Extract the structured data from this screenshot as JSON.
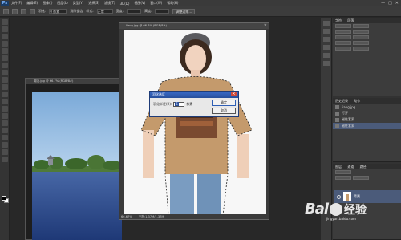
{
  "app": {
    "logo": "Ps",
    "menus": [
      "文件(F)",
      "编辑(E)",
      "图像(I)",
      "图层(L)",
      "类型(Y)",
      "选择(S)",
      "滤镜(T)",
      "3D(D)",
      "视图(V)",
      "窗口(W)",
      "帮助(H)"
    ],
    "window_controls": [
      "—",
      "□",
      "✕"
    ]
  },
  "options_bar": {
    "feather_label": "羽化:",
    "feather_value": "0 像素",
    "antialias_label": "消除锯齿",
    "style_label": "样式:",
    "style_value": "正常",
    "width_label": "宽度:",
    "height_label": "高度:",
    "refine_button": "调整边缘..."
  },
  "documents": {
    "lake": {
      "title": "湖泊.jpg @ 66.7% (RGB/8#)"
    },
    "girl": {
      "title": "liang.jpg @ 66.7% (RGB/8#)",
      "zoom": "66.67%",
      "doc_info": "文档:1.37M/1.37M"
    }
  },
  "dialog": {
    "title": "羽化选区",
    "radius_label": "羽化半径(R):",
    "radius_value": "5",
    "unit": "像素",
    "ok": "确定",
    "cancel": "取消"
  },
  "panels": {
    "character_tab": "字符",
    "paragraph_tab": "段落",
    "history_tab": "历史记录",
    "actions_tab": "动作",
    "history_items": [
      "liang.jpg",
      "打开",
      "磁性套索",
      "磁性套索"
    ],
    "history_selected_index": 3,
    "layers_tab": "图层",
    "channels_tab": "通道",
    "paths_tab": "路径",
    "layer_name": "背景"
  },
  "watermark": {
    "brand": "Bai",
    "brand_cn": "经验",
    "url": "jingyan.baidu.com"
  },
  "colors": {
    "accent_blue": "#2a4f9b",
    "selected_row": "#4b5b7a",
    "photoshop_bg": "#282828"
  }
}
